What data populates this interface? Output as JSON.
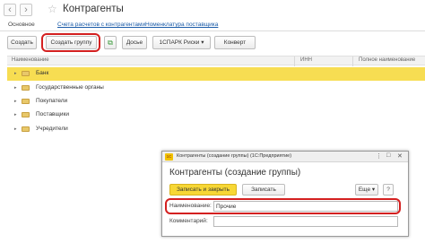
{
  "window": {
    "title": "Контрагенты",
    "star": "☆",
    "back": "‹",
    "forward": "›"
  },
  "tabs": [
    {
      "label": "Основное"
    },
    {
      "label": "Счета расчетов с контрагентами"
    },
    {
      "label": "Номенклатура поставщика"
    }
  ],
  "toolbar": {
    "create": "Создать",
    "create_group": "Создать группу",
    "copy_icon": "⧉",
    "dossier": "Досье",
    "spark": "1СПАРК Риски ▾",
    "convert": "Конверт"
  },
  "grid": {
    "columns": [
      "Наименование",
      "ИНН",
      "Полное наименование"
    ],
    "rows": [
      {
        "label": "Банк",
        "selected": true
      },
      {
        "label": "Государственные органы",
        "selected": false
      },
      {
        "label": "Покупатели",
        "selected": false
      },
      {
        "label": "Поставщики",
        "selected": false
      },
      {
        "label": "Учредители",
        "selected": false
      }
    ]
  },
  "dialog": {
    "bar_title": "Контрагенты (создание группы) (1С:Предприятие)",
    "logo": "1С",
    "controls": [
      "⋮",
      "□",
      "✕"
    ],
    "title": "Контрагенты (создание группы)",
    "save_close": "Записать и закрыть",
    "save": "Записать",
    "more": "Еще ▾",
    "help": "?",
    "name_label": "Наименование:",
    "name_value": "Прочие",
    "comment_label": "Комментарий:",
    "comment_value": ""
  },
  "colors": {
    "accent_yellow": "#f7dd52",
    "highlight_red": "#d42020",
    "link_blue": "#1a5ba8"
  }
}
